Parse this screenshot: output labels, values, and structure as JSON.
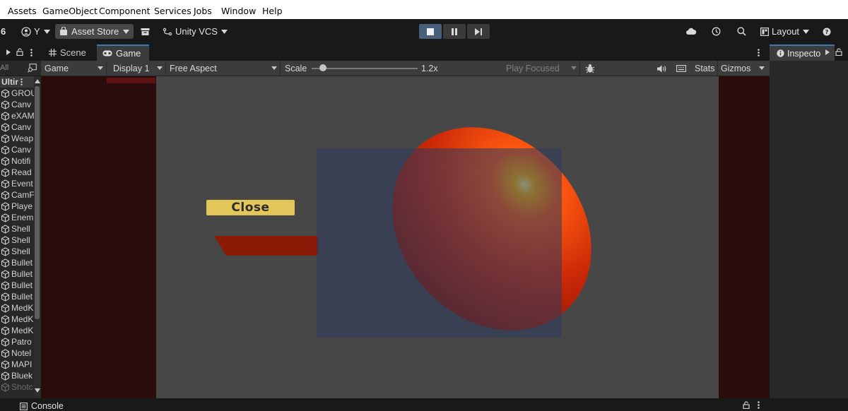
{
  "menu": {
    "items": [
      "Assets",
      "GameObject",
      "Component",
      "Services",
      "Jobs",
      "Window",
      "Help"
    ]
  },
  "toolbar": {
    "version_fragment": "6",
    "account_label": "Y",
    "asset_store_label": "Asset Store",
    "vcs_label": "Unity VCS",
    "layout_label": "Layout"
  },
  "hierarchy": {
    "search_placeholder": "All",
    "scene_name": "Ultir",
    "items": [
      "GROU",
      "Canv",
      "eXAM",
      "Canv",
      "Weap",
      "Canv",
      "Notifi",
      "Read",
      "Event",
      "CamF",
      "Playe",
      "Enem",
      "Shell",
      "Shell",
      "Shell",
      "Bullet",
      "Bullet",
      "Bullet",
      "Bullet",
      "MedK",
      "MedK",
      "MedK",
      "Patro",
      "Notel",
      "MAPI",
      "Bluek"
    ],
    "dim_items": [
      "Shotc"
    ]
  },
  "game_view": {
    "tabs": [
      "Scene",
      "Game"
    ],
    "active_tab": "Game",
    "mode_value": "Game",
    "display_value": "Display 1",
    "aspect_value": "Free Aspect",
    "scale_label": "Scale",
    "scale_value": "1.2x",
    "play_focused_value": "Play Focused",
    "stats_label": "Stats",
    "gizmos_label": "Gizmos",
    "scene_ui": {
      "close_button_label": "Close"
    }
  },
  "inspector": {
    "tab_label": "Inspecto"
  },
  "console": {
    "tab_label": "Console"
  },
  "colors": {
    "accent_blue": "#3a79bb",
    "close_button": "#e3c65a",
    "sphere": "#d9300a"
  }
}
